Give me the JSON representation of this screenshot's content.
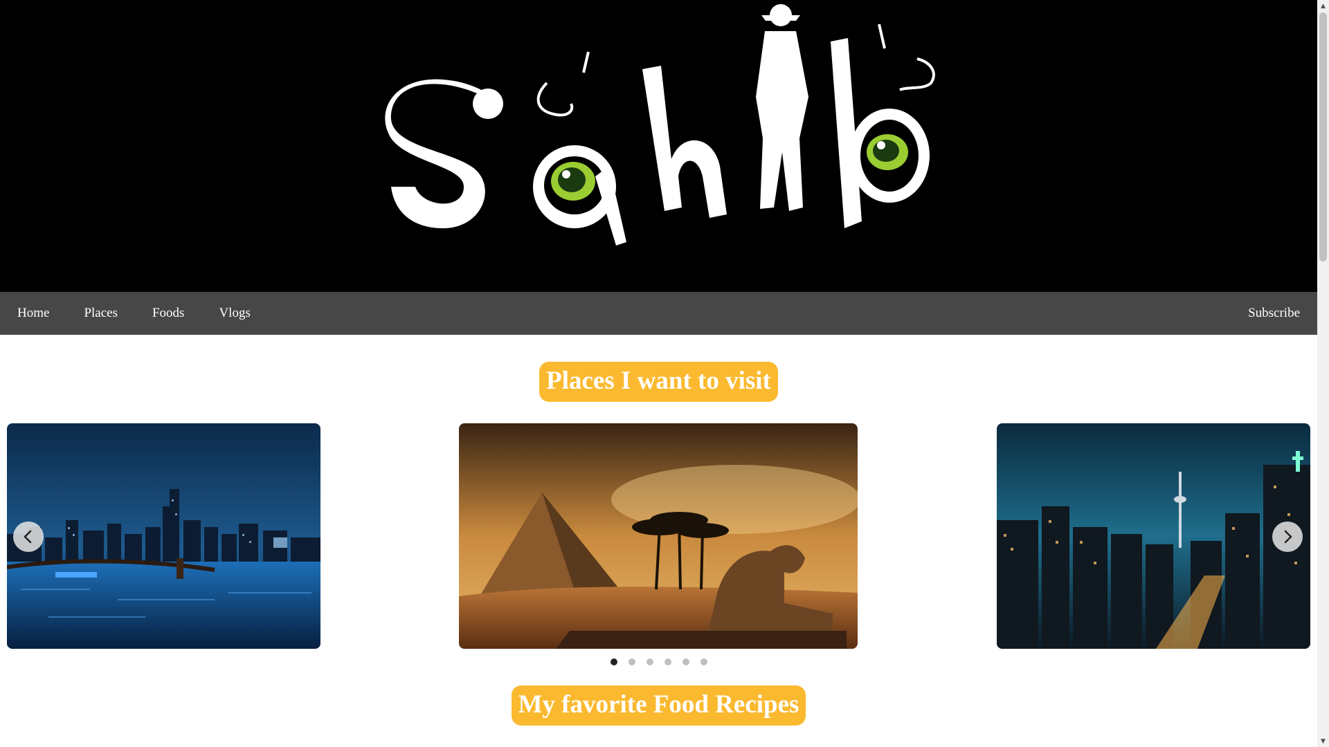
{
  "banner": {
    "logo_text": "Sahib",
    "logo_icon": "traveler-silhouette-with-cat-eyes"
  },
  "nav": {
    "items": [
      {
        "label": "Home"
      },
      {
        "label": "Places"
      },
      {
        "label": "Foods"
      },
      {
        "label": "Vlogs"
      }
    ],
    "subscribe_label": "Subscribe"
  },
  "places_section": {
    "heading": "Places I want to visit"
  },
  "carousel": {
    "slides": [
      {
        "image": "new-york-skyline-night-icon"
      },
      {
        "image": "pyramids-sphinx-desert-icon"
      },
      {
        "image": "toronto-cn-tower-night-icon"
      }
    ],
    "prev_icon": "chevron-left-icon",
    "next_icon": "chevron-right-icon",
    "dot_count": 6,
    "active_dot": 1
  },
  "food_section": {
    "heading": "My favorite Food Recipes"
  },
  "colors": {
    "banner_bg": "#000000",
    "nav_bg": "#474747",
    "pill_bg": "#fbb92f",
    "text_on_pill": "#ffffff"
  }
}
